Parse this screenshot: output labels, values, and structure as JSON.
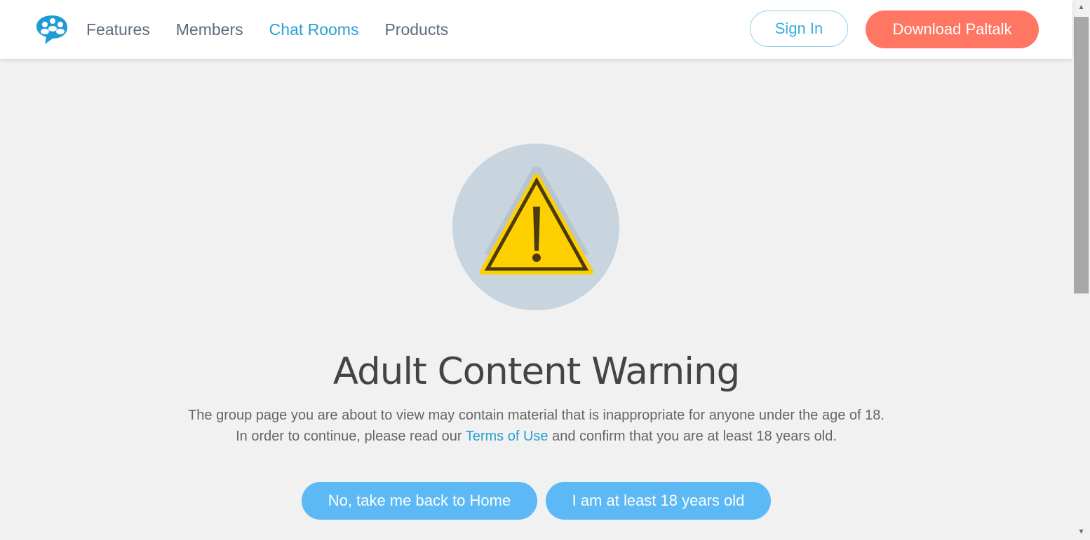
{
  "nav": {
    "items": [
      {
        "label": "Features",
        "active": false
      },
      {
        "label": "Members",
        "active": false
      },
      {
        "label": "Chat Rooms",
        "active": true
      },
      {
        "label": "Products",
        "active": false
      }
    ],
    "signin_label": "Sign In",
    "download_label": "Download Paltalk"
  },
  "main": {
    "title": "Adult Content Warning",
    "description_line1": "The group page you are about to view may contain material that is inappropriate for anyone under the age of 18.",
    "description_line2_before": "In order to continue, please read our ",
    "terms_link": "Terms of Use",
    "description_line2_after": " and confirm that you are at least 18 years old.",
    "home_button": "No, take me back to Home",
    "confirm_button": "I am at least 18 years old"
  },
  "icons": {
    "logo": "paltalk-logo-icon",
    "warning": "warning-triangle-icon"
  },
  "colors": {
    "accent": "#2b9fd3",
    "download": "#ff7663",
    "button": "#5cb9f5",
    "warning_yellow": "#ffd000",
    "circle": "#c8d4de"
  }
}
